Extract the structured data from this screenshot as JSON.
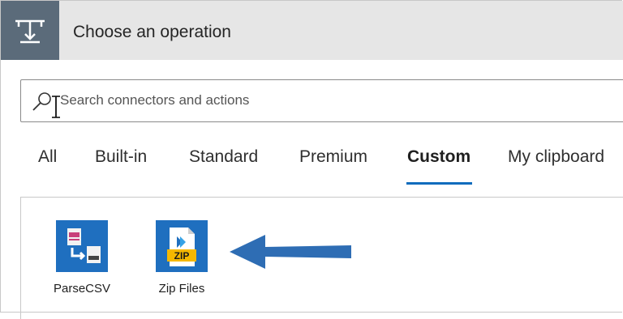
{
  "header": {
    "title": "Choose an operation",
    "icon": "operation-icon"
  },
  "search": {
    "placeholder": "Search connectors and actions",
    "value": "",
    "icon": "search-icon"
  },
  "tabs": [
    {
      "label": "All",
      "active": false
    },
    {
      "label": "Built-in",
      "active": false
    },
    {
      "label": "Standard",
      "active": false
    },
    {
      "label": "Premium",
      "active": false
    },
    {
      "label": "Custom",
      "active": true
    },
    {
      "label": "My clipboard",
      "active": false
    }
  ],
  "connectors": [
    {
      "label": "ParseCSV",
      "icon": "parse-csv-icon"
    },
    {
      "label": "Zip Files",
      "icon": "zip-files-icon"
    }
  ],
  "colors": {
    "header_bg": "#e6e6e6",
    "header_icon_bg": "#5b6b7a",
    "accent": "#0f6cbd",
    "tile_blue": "#1f6fbf",
    "annotation_arrow": "#2e6db4"
  }
}
